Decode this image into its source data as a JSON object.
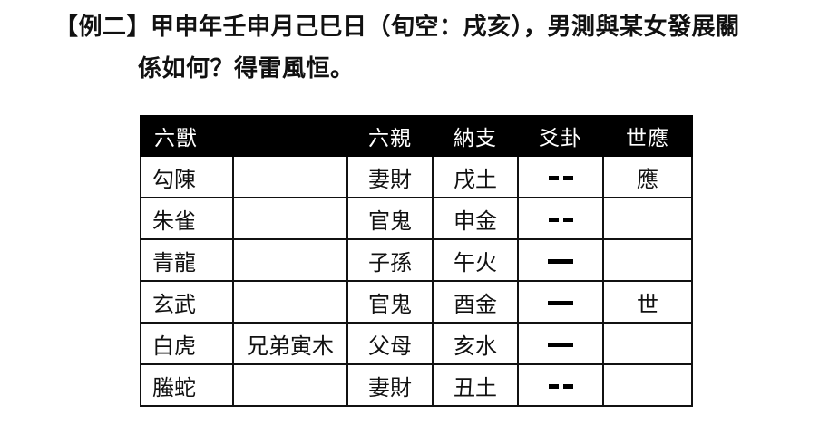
{
  "heading": {
    "line1": "【例二】甲申年壬申月己巳日（旬空：戌亥），男測與某女發展關",
    "line2": "係如何？得雷風恒。"
  },
  "table": {
    "headers": {
      "beast": "六獸",
      "hidden": "",
      "relation": "六親",
      "branch": "納支",
      "yao": "爻卦",
      "shiying": "世應"
    },
    "rows": [
      {
        "beast": "勾陳",
        "hidden": "",
        "relation": "妻財",
        "branch": "戌土",
        "yao": "yin",
        "shiying": "應"
      },
      {
        "beast": "朱雀",
        "hidden": "",
        "relation": "官鬼",
        "branch": "申金",
        "yao": "yin",
        "shiying": ""
      },
      {
        "beast": "青龍",
        "hidden": "",
        "relation": "子孫",
        "branch": "午火",
        "yao": "yang",
        "shiying": ""
      },
      {
        "beast": "玄武",
        "hidden": "",
        "relation": "官鬼",
        "branch": "酉金",
        "yao": "yang",
        "shiying": "世"
      },
      {
        "beast": "白虎",
        "hidden": "兄弟寅木",
        "relation": "父母",
        "branch": "亥水",
        "yao": "yang",
        "shiying": ""
      },
      {
        "beast": "螣蛇",
        "hidden": "",
        "relation": "妻財",
        "branch": "丑土",
        "yao": "yin",
        "shiying": ""
      }
    ]
  }
}
